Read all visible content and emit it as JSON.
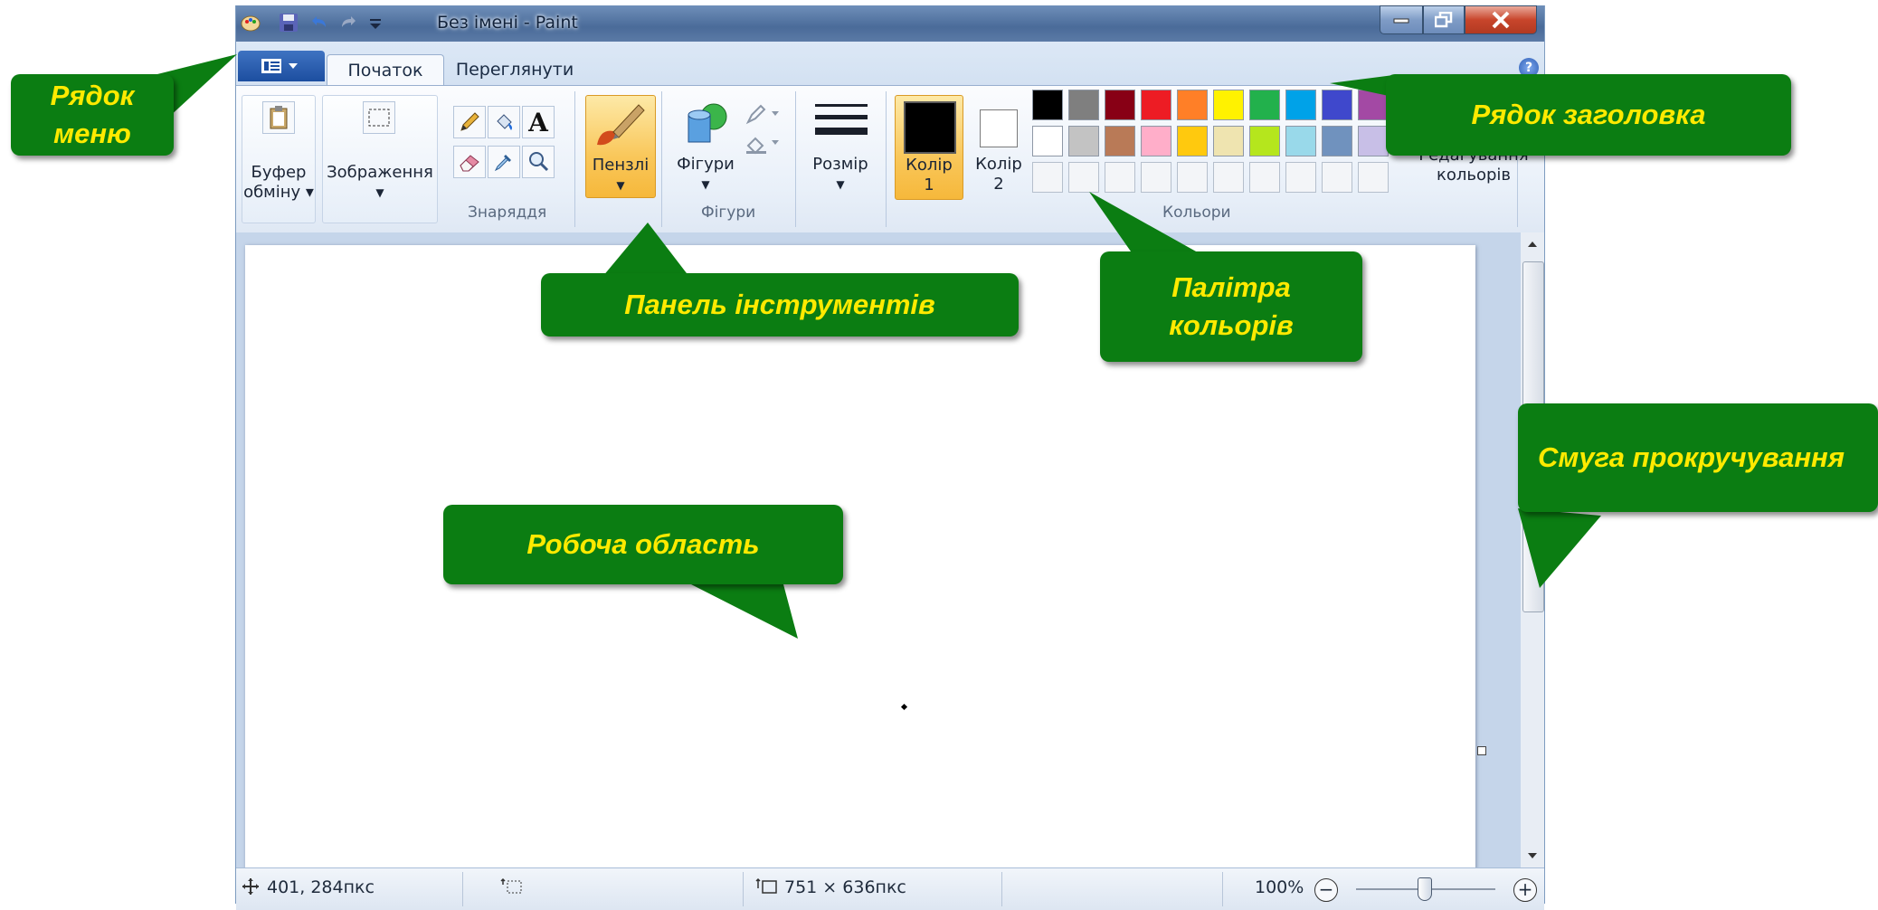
{
  "window": {
    "title": "Без імені - Paint"
  },
  "tabs": [
    {
      "label": "Початок"
    },
    {
      "label": "Переглянути"
    }
  ],
  "help_label": "?",
  "ribbon": {
    "clipboard": {
      "line1": "Буфер",
      "line2": "обміну ▾"
    },
    "image": {
      "label": "Зображення"
    },
    "tools_group_label": "Знаряддя",
    "text_tool_glyph": "A",
    "brushes_label": "Пензлі",
    "shapes_label": "Фігури",
    "shapes_group_label": "Фігури",
    "size_label": "Розмір",
    "color1": {
      "line1": "Колір",
      "line2": "1"
    },
    "color2": {
      "line1": "Колір",
      "line2": "2"
    },
    "edit_colors": {
      "line1": "Редагування",
      "line2": "кольорів"
    },
    "colors_group_label": "Кольори",
    "palette_row1": [
      "#000000",
      "#7f7f7f",
      "#880015",
      "#ed1c24",
      "#ff7f27",
      "#fff200",
      "#22b14c",
      "#00a2e8",
      "#3f48cc",
      "#a349a4"
    ],
    "palette_row2": [
      "#ffffff",
      "#c3c3c3",
      "#b97a57",
      "#ffaec9",
      "#ffc90e",
      "#efe4b0",
      "#b5e61d",
      "#99d9ea",
      "#7092be",
      "#c8bfe7"
    ]
  },
  "status": {
    "cursor_pos": "401, 284пкс",
    "canvas_size": "751 × 636пкс",
    "zoom": "100%",
    "zoom_minus": "−",
    "zoom_plus": "+"
  },
  "callouts": {
    "menu_bar": {
      "line1": "Рядок",
      "line2": "меню"
    },
    "title_bar": "Рядок заголовка",
    "toolbar": "Панель інструментів",
    "palette": {
      "line1": "Палітра",
      "line2": "кольорів"
    },
    "scrollbar": "Смуга прокручування",
    "workspace": "Робоча область"
  }
}
